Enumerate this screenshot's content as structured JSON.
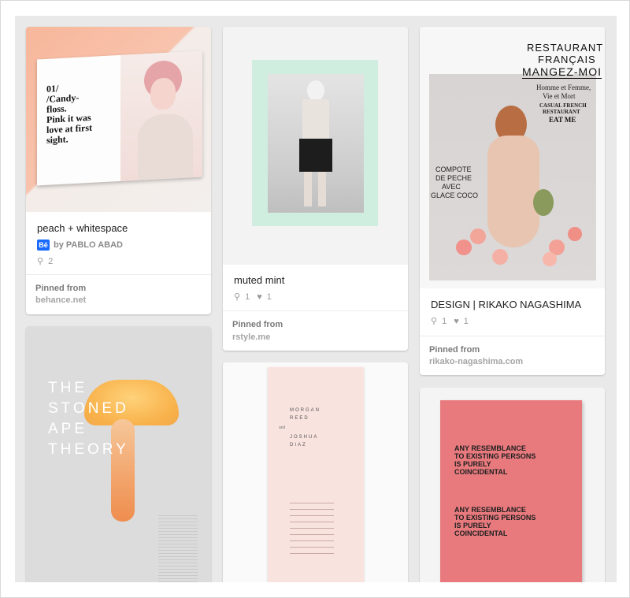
{
  "pins": [
    {
      "title": "peach + whitespace",
      "attribution": "by PABLO ABAD",
      "attribution_icon": "behance-icon",
      "badge": "Bē",
      "repins": "2",
      "pinned_from_label": "Pinned from",
      "source": "behance.net",
      "image": {
        "heading": "01/\n/Candy-\nfloss.\nPink it was\nlove at first\nsight."
      }
    },
    {
      "title": "muted mint",
      "repins": "1",
      "likes": "1",
      "pinned_from_label": "Pinned from",
      "source": "rstyle.me"
    },
    {
      "title": "DESIGN | RIKAKO NAGASHIMA",
      "repins": "1",
      "likes": "1",
      "pinned_from_label": "Pinned from",
      "source": "rikako-nagashima.com",
      "image": {
        "line1": "RESTAURANT",
        "line2": "FRANÇAIS",
        "line3": "MANGEZ-MOI",
        "line4": "Homme et Femme,",
        "line5": "Vie et Mort",
        "line6": "CASUAL FRENCH",
        "line7": "RESTAURANT",
        "line8": "EAT ME",
        "line9": "COMPOTE",
        "line10": "DE PECHE",
        "line11": "AVEC",
        "line12": "GLACE COCO"
      }
    },
    {
      "image": {
        "l1": "THE",
        "l2": "STONED",
        "l3": "APE",
        "l4": "THEORY"
      }
    },
    {
      "image": {
        "n1": "MORGAN",
        "n2": "REED",
        "n3": "and",
        "n4": "JOSHUA",
        "n5": "DIAZ"
      }
    },
    {
      "image": {
        "h1": "ANY RESEMBLANCE",
        "h2": "TO EXISTING PERSONS",
        "h3": "IS PURELY",
        "h4": "COINCIDENTAL"
      }
    }
  ],
  "colors": {
    "board_bg": "#e9e9e9",
    "peach": "#f6b59a",
    "mint": "#cfeee0",
    "pink": "#f9e3df",
    "coral": "#e87a7e"
  }
}
